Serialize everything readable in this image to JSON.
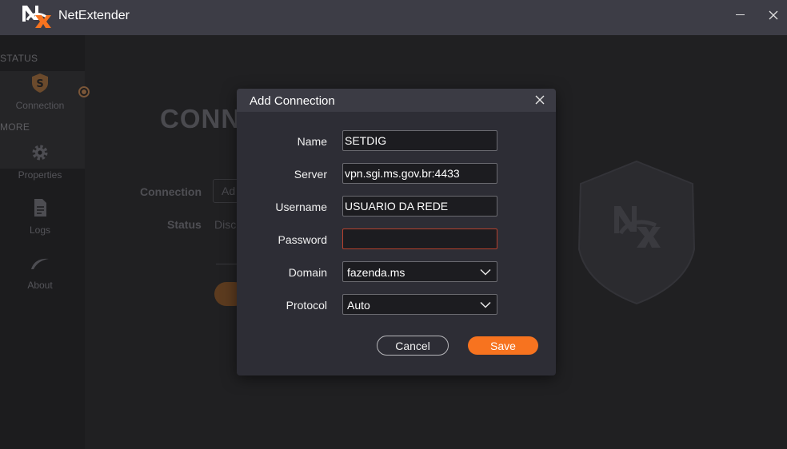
{
  "window": {
    "app_title": "NetExtender"
  },
  "sidebar": {
    "status_section": "STATUS",
    "more_section": "MORE",
    "items": [
      {
        "label": "Connection",
        "icon": "shield-s-icon"
      },
      {
        "label": "Properties",
        "icon": "gear-icon"
      },
      {
        "label": "Logs",
        "icon": "document-icon"
      },
      {
        "label": "About",
        "icon": "swoosh-icon"
      }
    ]
  },
  "background_page": {
    "title": "CONN",
    "connection_label": "Connection",
    "connection_value": "Ad",
    "status_label": "Status",
    "status_value": "Disc"
  },
  "dialog": {
    "title": "Add Connection",
    "fields": {
      "name": {
        "label": "Name",
        "value": "SETDIG"
      },
      "server": {
        "label": "Server",
        "value": "vpn.sgi.ms.gov.br:4433"
      },
      "username": {
        "label": "Username",
        "value": "USUARIO DA REDE"
      },
      "password": {
        "label": "Password",
        "value": ""
      },
      "domain": {
        "label": "Domain",
        "value": "fazenda.ms"
      },
      "protocol": {
        "label": "Protocol",
        "value": "Auto"
      }
    },
    "cancel_label": "Cancel",
    "save_label": "Save"
  },
  "colors": {
    "accent": "#f7731f",
    "titlebar": "#3d3d46",
    "dialog_bg": "#2d2d35",
    "error_border": "#b5412e"
  }
}
